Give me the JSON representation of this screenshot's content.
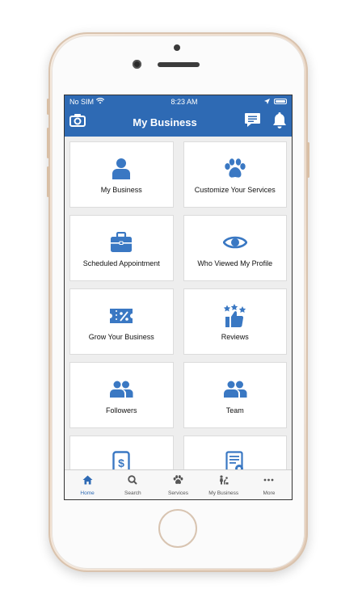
{
  "status_bar": {
    "carrier": "No SIM",
    "time": "8:23 AM"
  },
  "header": {
    "title": "My Business"
  },
  "tiles": [
    {
      "label": "My Business"
    },
    {
      "label": "Customize Your Services"
    },
    {
      "label": "Scheduled Appointment"
    },
    {
      "label": "Who Viewed My Profile"
    },
    {
      "label": "Grow Your Business"
    },
    {
      "label": "Reviews"
    },
    {
      "label": "Followers"
    },
    {
      "label": "Team"
    },
    {
      "label": ""
    },
    {
      "label": ""
    }
  ],
  "tabs": [
    {
      "label": "Home",
      "icon": "home-icon"
    },
    {
      "label": "Search",
      "icon": "search-icon"
    },
    {
      "label": "Services",
      "icon": "paw-icon"
    },
    {
      "label": "My Business",
      "icon": "business-icon"
    },
    {
      "label": "More",
      "icon": "more-icon"
    }
  ],
  "colors": {
    "accent": "#2e6ab4",
    "icon": "#3a78c3",
    "screen_bg": "#eeeeee"
  }
}
